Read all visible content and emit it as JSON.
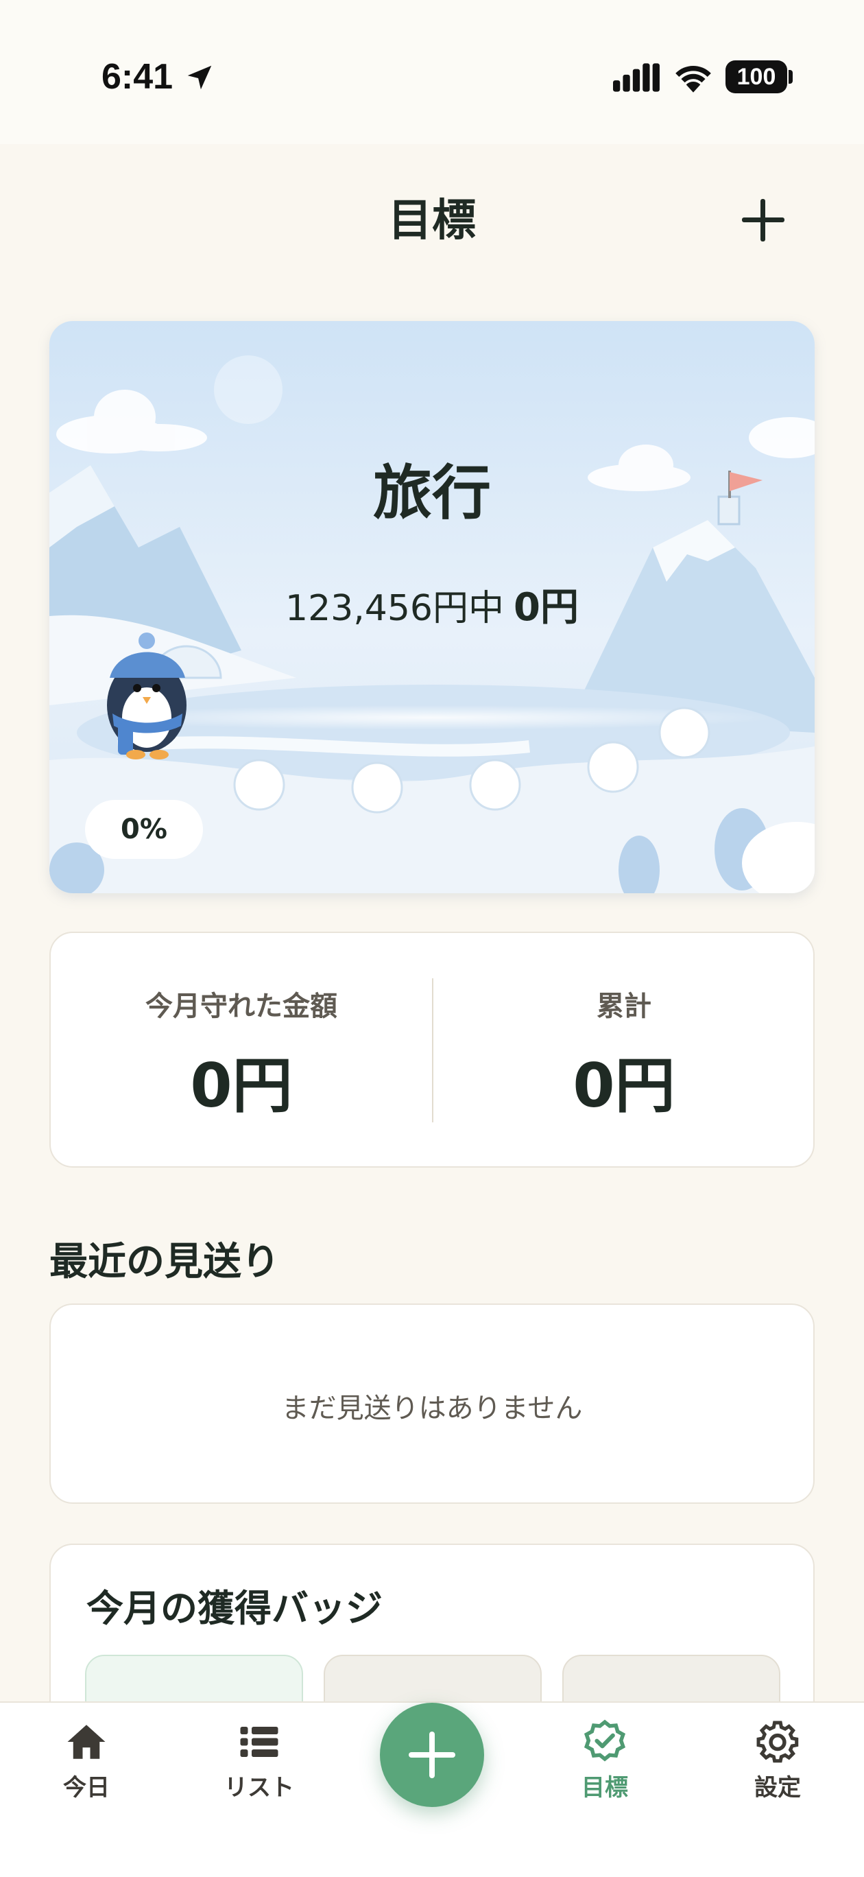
{
  "status_bar": {
    "time": "6:41",
    "battery": "100"
  },
  "header": {
    "title": "目標",
    "add_button": "add-goal"
  },
  "goal": {
    "name": "旅行",
    "target_text": "123,456円中",
    "saved_text": "0円",
    "progress": 0,
    "progress_label": "0%"
  },
  "stats": {
    "month_label": "今月守れた金額",
    "month_value": "0円",
    "total_label": "累計",
    "total_value": "0円"
  },
  "recent": {
    "title": "最近の見送り",
    "empty_text": "まだ見送りはありません"
  },
  "badges": {
    "title": "今月の獲得バッジ"
  },
  "tabs": [
    {
      "label": "今日",
      "icon": "home-icon"
    },
    {
      "label": "リスト",
      "icon": "list-icon"
    },
    {
      "label": "目標",
      "icon": "verified-badge-icon",
      "active": true
    },
    {
      "label": "設定",
      "icon": "gear-icon"
    }
  ],
  "colors": {
    "accent": "#5aa67b",
    "background": "#faf7f0"
  }
}
